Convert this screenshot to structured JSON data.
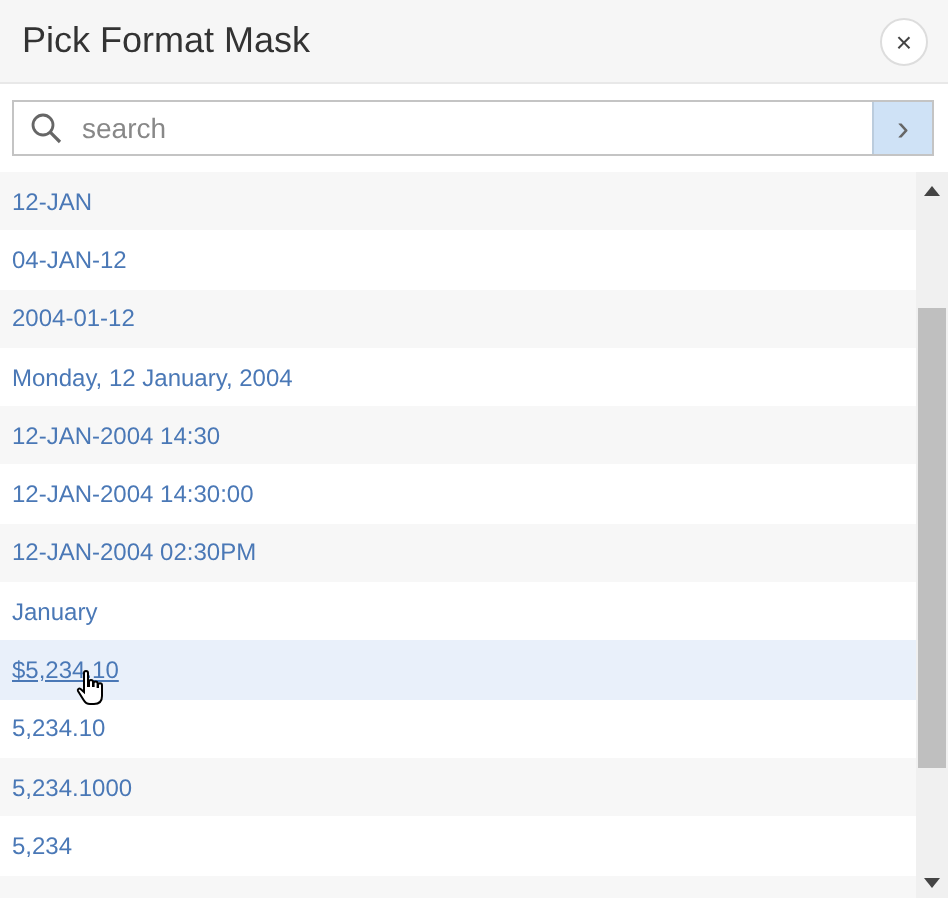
{
  "dialog": {
    "title": "Pick Format Mask",
    "close": "×"
  },
  "search": {
    "placeholder": "search",
    "go": "›"
  },
  "items": [
    {
      "label": "12-JAN",
      "hovered": false
    },
    {
      "label": "04-JAN-12",
      "hovered": false
    },
    {
      "label": "2004-01-12",
      "hovered": false
    },
    {
      "label": "Monday, 12 January, 2004",
      "hovered": false
    },
    {
      "label": "12-JAN-2004 14:30",
      "hovered": false
    },
    {
      "label": "12-JAN-2004 14:30:00",
      "hovered": false
    },
    {
      "label": "12-JAN-2004 02:30PM",
      "hovered": false
    },
    {
      "label": "January",
      "hovered": false
    },
    {
      "label": "$5,234.10",
      "hovered": true
    },
    {
      "label": "5,234.10",
      "hovered": false
    },
    {
      "label": "5,234.1000",
      "hovered": false
    },
    {
      "label": "5,234",
      "hovered": false
    }
  ]
}
